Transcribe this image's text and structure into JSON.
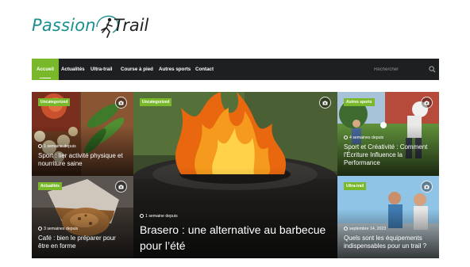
{
  "logo": {
    "word1": "Passion",
    "word2": "Trail",
    "runner_icon": "runner-icon"
  },
  "nav": {
    "items": [
      {
        "label": "Accueil",
        "active": true
      },
      {
        "label": "Actualités"
      },
      {
        "label": "Ultra-trail"
      },
      {
        "label": "Course à pied"
      },
      {
        "label": "Autres sports"
      },
      {
        "label": "Contact"
      }
    ],
    "search_placeholder": "Rechercher",
    "search_icon": "magnifier-icon",
    "accent_color": "#78b82a",
    "bar_color": "#1e1f21"
  },
  "posts": [
    {
      "category": "Uncategorized",
      "date": "1 semaine depuis",
      "title": "Sport : lier activité physique et nourriture saine",
      "icon": "camera-icon"
    },
    {
      "category": "Uncategorized",
      "date": "1 semaine depuis",
      "title": "Brasero : une alternative au barbecue pour l’été",
      "icon": "camera-icon"
    },
    {
      "category": "Autres sports",
      "date": "4 semaines depuis",
      "title": "Sport et Créativité : Comment l'Écriture Influence la Performance",
      "icon": "camera-icon"
    },
    {
      "category": "Actualités",
      "date": "3 semaines depuis",
      "title": "Café : bien le préparer pour être en forme",
      "icon": "camera-icon"
    },
    {
      "category": "Ultra-trail",
      "date": "septembre 14, 2023",
      "title": "Quels sont les équipements indispensables pour un trail ?",
      "icon": "camera-icon"
    }
  ]
}
